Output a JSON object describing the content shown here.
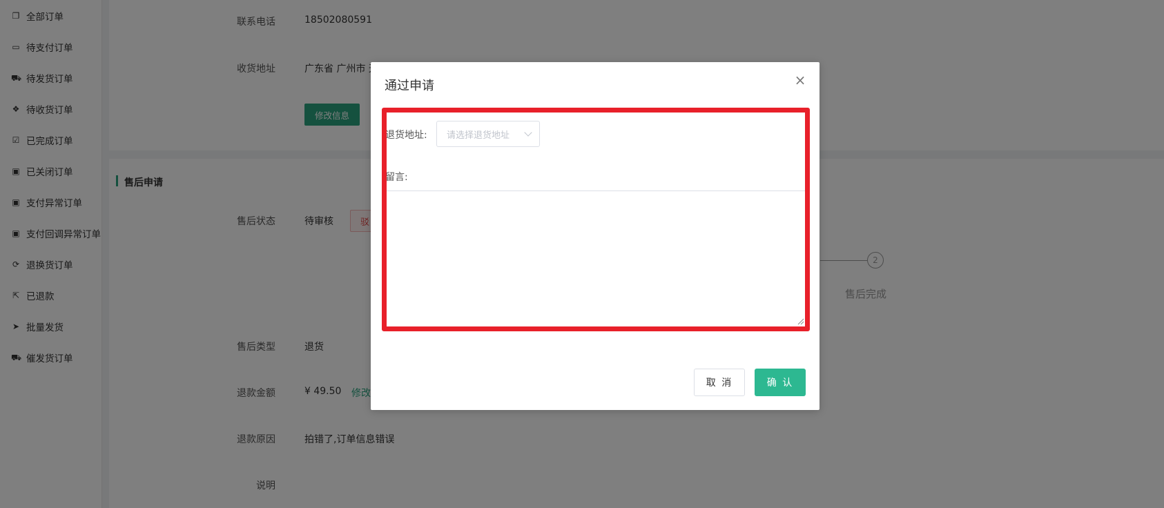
{
  "sidebar": {
    "items": [
      {
        "label": "全部订单",
        "icon": "copy-icon"
      },
      {
        "label": "待支付订单",
        "icon": "credit-card-icon"
      },
      {
        "label": "待发货订单",
        "icon": "truck-icon"
      },
      {
        "label": "待收货订单",
        "icon": "dropbox-icon"
      },
      {
        "label": "已完成订单",
        "icon": "check-square-icon"
      },
      {
        "label": "已关闭订单",
        "icon": "trash-icon"
      },
      {
        "label": "支付异常订单",
        "icon": "trash-icon"
      },
      {
        "label": "支付回调异常订单",
        "icon": "trash-icon"
      },
      {
        "label": "退换货订单",
        "icon": "refresh-icon"
      },
      {
        "label": "已退款",
        "icon": "share-square-icon"
      },
      {
        "label": "批量发货",
        "icon": "paper-plane-icon"
      },
      {
        "label": "催发货订单",
        "icon": "truck-icon"
      }
    ]
  },
  "order_info": {
    "phone_label": "联系电话",
    "phone_value": "18502080591",
    "address_label": "收货地址",
    "address_value": "广东省 广州市 天",
    "edit_button": "修改信息"
  },
  "after_sale": {
    "section_title": "售后申请",
    "status_label": "售后状态",
    "status_value": "待审核",
    "reject_button": "驳",
    "step_number": "2",
    "step_label": "售后完成",
    "type_label": "售后类型",
    "type_value": "退货",
    "amount_label": "退款金额",
    "amount_value": "¥ 49.50",
    "amount_edit": "修改",
    "reason_label": "退款原因",
    "reason_value": "拍错了,订单信息错误",
    "note_label": "说明"
  },
  "modal": {
    "title": "通过申请",
    "close_icon": "×",
    "return_address_label": "退货地址:",
    "return_address_placeholder": "请选择退货地址",
    "message_label": "留言:",
    "cancel_button": "取 消",
    "confirm_button": "确 认"
  },
  "colors": {
    "accent": "#2ba37f",
    "confirm": "#2db891",
    "highlight": "#e8202a",
    "overlay": "rgba(0,0,0,0.5)"
  }
}
